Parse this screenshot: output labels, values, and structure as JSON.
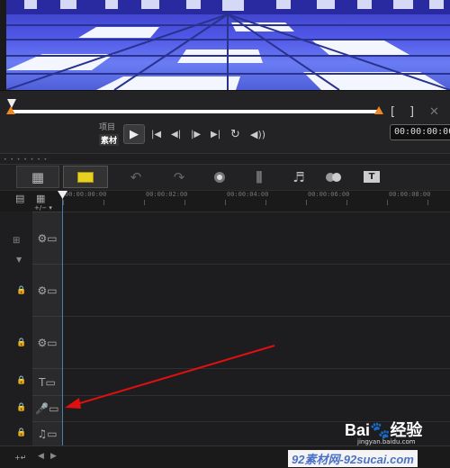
{
  "player": {
    "mode_project": "项目",
    "mode_clip": "素材",
    "timecode": "00:00:00:00",
    "buttons": {
      "play": "▶",
      "go_start": "⏮",
      "prev_frame": "◀|",
      "next_frame": "|▶",
      "go_end": "⏭",
      "repeat": "↻",
      "volume": "🔊",
      "mark_in": "[",
      "mark_out": "]",
      "cut": "✕"
    }
  },
  "toolbar": {
    "icons": [
      "storyboard-view",
      "timeline-view",
      "undo",
      "redo",
      "record-capture",
      "mix-audio",
      "auto-music",
      "multi-trim",
      "title"
    ]
  },
  "ruler": {
    "labels": [
      "00:00:00:00",
      "00:00:02:00",
      "00:00:04:00",
      "00:00:06:00",
      "00:00:08:00"
    ],
    "mode_toggle": "+/− ▾"
  },
  "tracks": [
    {
      "name": "video-track",
      "icon": "🎞"
    },
    {
      "name": "overlay-track-1",
      "icon": "🎞"
    },
    {
      "name": "overlay-track-2",
      "icon": "🎞"
    },
    {
      "name": "title-track",
      "icon": "T"
    },
    {
      "name": "voice-track",
      "icon": "🎤"
    },
    {
      "name": "music-track",
      "icon": "♫"
    }
  ],
  "watermark": {
    "brand": "Bai",
    "brand2": "百",
    "brand3": "经验",
    "sub": "jingyan.baidu.com",
    "site": "92素材网-92sucai.com"
  },
  "colors": {
    "accent": "#f08a20",
    "playhead": "#4a7fae",
    "arrow": "#e01010"
  }
}
